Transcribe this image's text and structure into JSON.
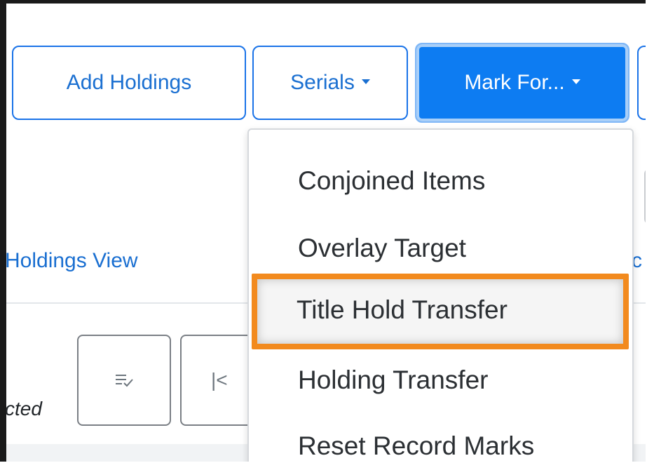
{
  "toolbar": {
    "add_holdings": "Add Holdings",
    "serials": "Serials",
    "mark_for": "Mark For..."
  },
  "links": {
    "holdings_view": "Holdings View",
    "partial_right": "rc"
  },
  "status": {
    "partial_selected": "cted"
  },
  "pager": {
    "first_icon": "|<"
  },
  "mark_for_menu": {
    "items": [
      "Conjoined Items",
      "Overlay Target",
      "Title Hold Transfer",
      "Holding Transfer",
      "Reset Record Marks"
    ],
    "highlighted_index": 2
  },
  "colors": {
    "primary": "#0d7cf2",
    "link": "#1a6fd1",
    "highlight_outline": "#f28a1e"
  },
  "icons": [
    "caret-down-icon",
    "sort-check-icon",
    "first-page-icon"
  ]
}
